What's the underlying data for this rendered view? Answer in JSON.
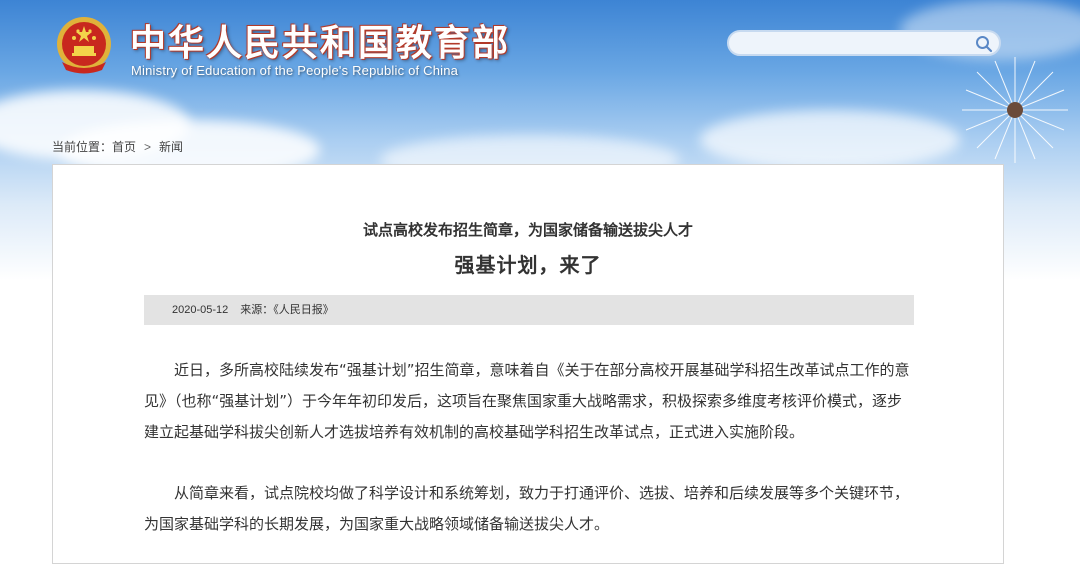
{
  "header": {
    "site_title": "中华人民共和国教育部",
    "site_subtitle": "Ministry of Education of the People's Republic of China",
    "emblem_icon": "national-emblem-icon",
    "search": {
      "placeholder": "",
      "icon": "search-icon"
    }
  },
  "breadcrumb": {
    "label": "当前位置：",
    "items": [
      "首页",
      "新闻"
    ],
    "separator": ">"
  },
  "article": {
    "kicker": "试点高校发布招生简章，为国家储备输送拔尖人才",
    "headline": "强基计划，来了",
    "meta": {
      "date": "2020-05-12",
      "source_label": "来源：《人民日报》"
    },
    "paragraphs": [
      "近日，多所高校陆续发布“强基计划”招生简章，意味着自《关于在部分高校开展基础学科招生改革试点工作的意见》（也称“强基计划”）于今年年初印发后，这项旨在聚焦国家重大战略需求，积极探索多维度考核评价模式，逐步建立起基础学科拔尖创新人才选拔培养有效机制的高校基础学科招生改革试点，正式进入实施阶段。",
      "从简章来看，试点院校均做了科学设计和系统筹划，致力于打通评价、选拔、培养和后续发展等多个关键环节，为国家基础学科的长期发展，为国家重大战略领域储备输送拔尖人才。"
    ]
  },
  "colors": {
    "sky_top": "#3d84d4",
    "title_outline": "#b23a2a",
    "meta_bar": "#e3e3e3",
    "text": "#333333"
  }
}
